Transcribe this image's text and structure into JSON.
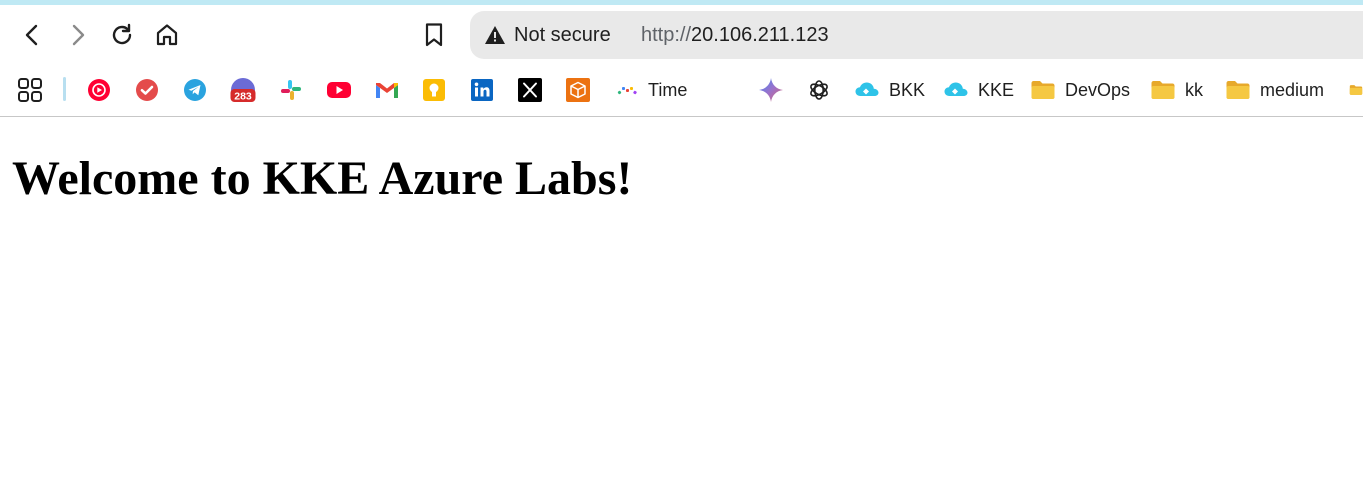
{
  "browser": {
    "address_bar": {
      "security_label": "Not secure",
      "url_scheme": "http://",
      "url_host": "20.106.211.123"
    },
    "toolbar_icons": [
      "back-icon",
      "forward-icon",
      "reload-icon",
      "home-icon",
      "bookmark-icon",
      "warning-icon"
    ],
    "bookmarks_bar": {
      "items": [
        {
          "icon": "apps-grid-icon",
          "label": ""
        },
        {
          "icon": "youtube-music-icon",
          "label": ""
        },
        {
          "icon": "todoist-icon",
          "label": ""
        },
        {
          "icon": "telegram-icon",
          "label": ""
        },
        {
          "icon": "calendar-icon",
          "label": "",
          "badge": "283"
        },
        {
          "icon": "slack-icon",
          "label": ""
        },
        {
          "icon": "youtube-icon",
          "label": ""
        },
        {
          "icon": "gmail-icon",
          "label": ""
        },
        {
          "icon": "keep-icon",
          "label": ""
        },
        {
          "icon": "linkedin-icon",
          "label": ""
        },
        {
          "icon": "x-icon",
          "label": ""
        },
        {
          "icon": "package-icon",
          "label": ""
        },
        {
          "icon": "time-icon",
          "label": "Time"
        },
        {
          "icon": "gemini-icon",
          "label": ""
        },
        {
          "icon": "chatgpt-icon",
          "label": ""
        },
        {
          "icon": "cloud-icon",
          "label": "BKK"
        },
        {
          "icon": "cloud-icon",
          "label": "KKE"
        },
        {
          "icon": "folder-icon",
          "label": "DevOps"
        },
        {
          "icon": "folder-icon",
          "label": "kk"
        },
        {
          "icon": "folder-icon",
          "label": "medium"
        },
        {
          "icon": "folder-icon",
          "label": ""
        }
      ]
    }
  },
  "page": {
    "heading": "Welcome to KKE Azure Labs!"
  },
  "colors": {
    "top_strip": "#bfe9f4",
    "omnibox_bg": "#e9e9e9",
    "folder": "#f5c842",
    "youtube_red": "#ff0033",
    "telegram_blue": "#2aa3df",
    "linkedin_blue": "#0a66c2"
  }
}
